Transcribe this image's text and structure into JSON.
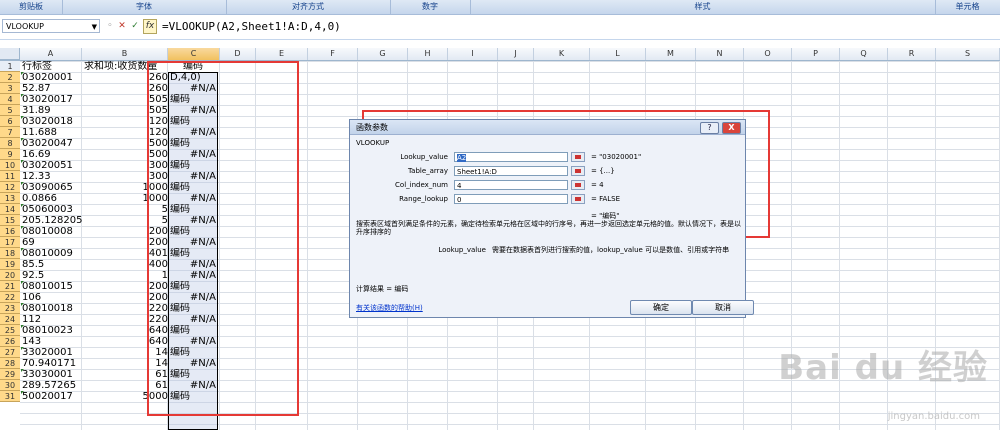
{
  "ribbon": {
    "groups": [
      "剪贴板",
      "字体",
      "对齐方式",
      "数字",
      "样式",
      "单元格"
    ]
  },
  "formula_bar": {
    "name_box": "VLOOKUP",
    "cancel_icon": "✕",
    "enter_icon": "✓",
    "fx_label": "fx",
    "formula": "=VLOOKUP(A2,Sheet1!A:D,4,0)"
  },
  "columns": [
    "A",
    "B",
    "C",
    "D",
    "E",
    "F",
    "G",
    "H",
    "I",
    "J",
    "K",
    "L",
    "M",
    "N",
    "O",
    "P",
    "Q",
    "R",
    "S"
  ],
  "rows": [
    {
      "n": "1",
      "a": "行标签",
      "b": "求和项:收货数量",
      "c": "编码",
      "cr": false
    },
    {
      "n": "2",
      "a": "03020001",
      "b": "260",
      "c": "D,4,0)",
      "cr": false
    },
    {
      "n": "3",
      "a": "52.87",
      "b": "260",
      "c": "#N/A",
      "cr": true
    },
    {
      "n": "4",
      "a": "03020017",
      "b": "505",
      "c": "编码",
      "cr": false
    },
    {
      "n": "5",
      "a": "31.89",
      "b": "505",
      "c": "#N/A",
      "cr": true
    },
    {
      "n": "6",
      "a": "03020018",
      "b": "120",
      "c": "编码",
      "cr": false
    },
    {
      "n": "7",
      "a": "11.688",
      "b": "120",
      "c": "#N/A",
      "cr": true
    },
    {
      "n": "8",
      "a": "03020047",
      "b": "500",
      "c": "编码",
      "cr": false
    },
    {
      "n": "9",
      "a": "16.69",
      "b": "500",
      "c": "#N/A",
      "cr": true
    },
    {
      "n": "10",
      "a": "03020051",
      "b": "300",
      "c": "编码",
      "cr": false
    },
    {
      "n": "11",
      "a": "12.33",
      "b": "300",
      "c": "#N/A",
      "cr": true
    },
    {
      "n": "12",
      "a": "03090065",
      "b": "1000",
      "c": "编码",
      "cr": false
    },
    {
      "n": "13",
      "a": "0.0866",
      "b": "1000",
      "c": "#N/A",
      "cr": true
    },
    {
      "n": "14",
      "a": "05060003",
      "b": "5",
      "c": "编码",
      "cr": false
    },
    {
      "n": "15",
      "a": "205.128205",
      "b": "5",
      "c": "#N/A",
      "cr": true
    },
    {
      "n": "16",
      "a": "08010008",
      "b": "200",
      "c": "编码",
      "cr": false
    },
    {
      "n": "17",
      "a": "69",
      "b": "200",
      "c": "#N/A",
      "cr": true
    },
    {
      "n": "18",
      "a": "08010009",
      "b": "401",
      "c": "编码",
      "cr": false
    },
    {
      "n": "19",
      "a": "85.5",
      "b": "400",
      "c": "#N/A",
      "cr": true
    },
    {
      "n": "20",
      "a": "92.5",
      "b": "1",
      "c": "#N/A",
      "cr": true
    },
    {
      "n": "21",
      "a": "08010015",
      "b": "200",
      "c": "编码",
      "cr": false
    },
    {
      "n": "22",
      "a": "106",
      "b": "200",
      "c": "#N/A",
      "cr": true
    },
    {
      "n": "23",
      "a": "08010018",
      "b": "220",
      "c": "编码",
      "cr": false
    },
    {
      "n": "24",
      "a": "112",
      "b": "220",
      "c": "#N/A",
      "cr": true
    },
    {
      "n": "25",
      "a": "08010023",
      "b": "640",
      "c": "编码",
      "cr": false
    },
    {
      "n": "26",
      "a": "143",
      "b": "640",
      "c": "#N/A",
      "cr": true
    },
    {
      "n": "27",
      "a": "33020001",
      "b": "14",
      "c": "编码",
      "cr": false
    },
    {
      "n": "28",
      "a": "70.940171",
      "b": "14",
      "c": "#N/A",
      "cr": true
    },
    {
      "n": "29",
      "a": "33030001",
      "b": "61",
      "c": "编码",
      "cr": false
    },
    {
      "n": "30",
      "a": "289.57265",
      "b": "61",
      "c": "#N/A",
      "cr": true
    },
    {
      "n": "31",
      "a": "50020017",
      "b": "5000",
      "c": "编码",
      "cr": false
    }
  ],
  "dialog": {
    "title": "函数参数",
    "help_btn": "?",
    "close_btn": "X",
    "function_name": "VLOOKUP",
    "args": [
      {
        "label": "Lookup_value",
        "value": "A2",
        "result": "= \"03020001\"",
        "highlight": true
      },
      {
        "label": "Table_array",
        "value": "Sheet1!A:D",
        "result": "= {...}",
        "highlight": false
      },
      {
        "label": "Col_index_num",
        "value": "4",
        "result": "= 4",
        "highlight": false
      },
      {
        "label": "Range_lookup",
        "value": "0",
        "result": "= FALSE",
        "highlight": false
      }
    ],
    "result_line": "= \"编码\"",
    "description": "搜索表区域首列满足条件的元素，确定待检索单元格在区域中的行序号，再进一步返回选定单元格的值。默认情况下，表是以升序排序的",
    "arg_name": "Lookup_value",
    "arg_help": "需要在数据表首列进行搜索的值，lookup_value 可以是数值、引用或字符串",
    "calc_result": "计算结果 = 编码",
    "help_link": "有关该函数的帮助(H)",
    "ok": "确定",
    "cancel": "取消"
  },
  "watermark": {
    "main": "Bai du 经验",
    "sub": "jingyan.baidu.com"
  },
  "colors": {
    "accent_red": "#e53935",
    "row_header_selected": "#ffd98a",
    "link": "#0033cc"
  }
}
